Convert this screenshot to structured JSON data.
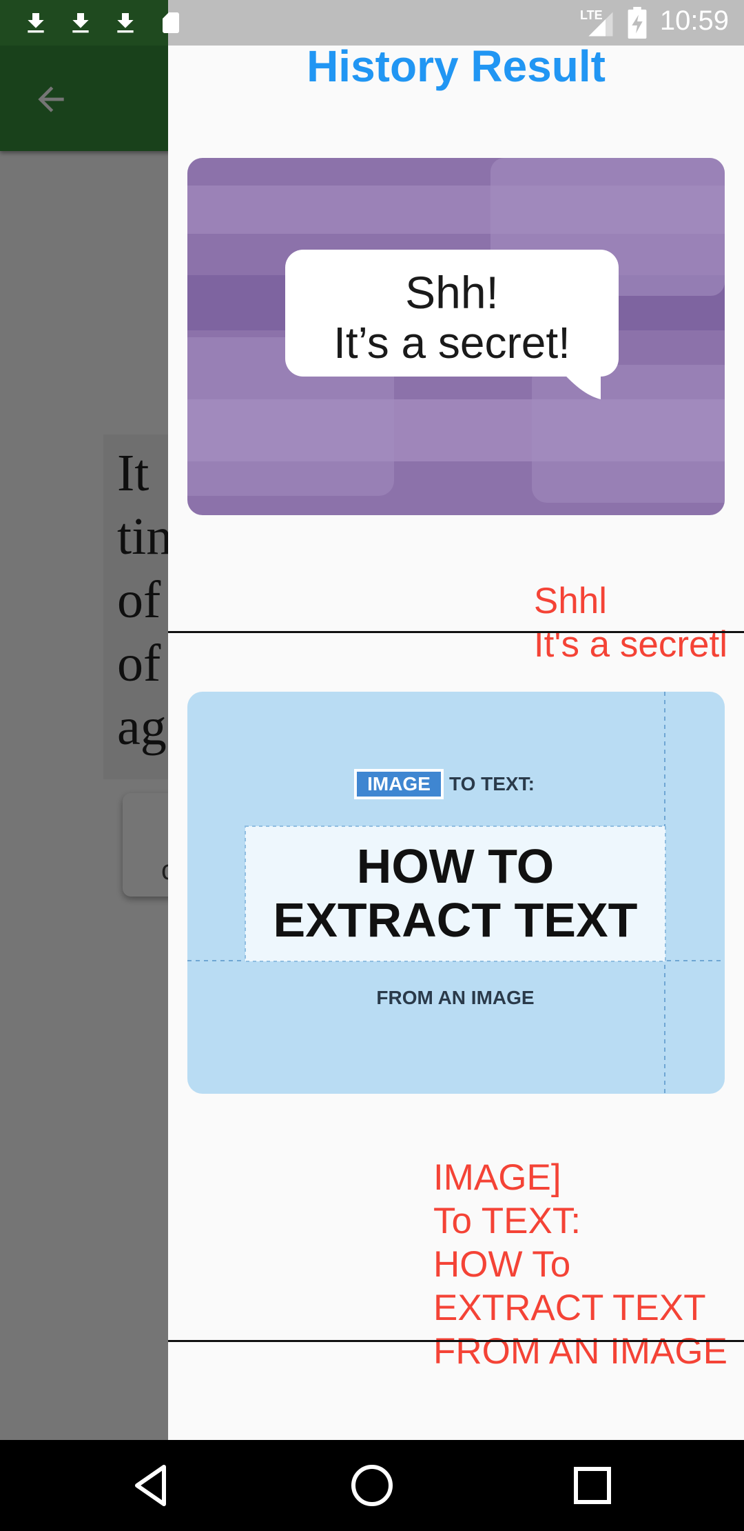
{
  "status_bar": {
    "time": "10:59",
    "network_label": "LTE",
    "left_icons": [
      "download-icon",
      "download-icon",
      "download-icon",
      "sd-card-icon"
    ],
    "right_icons": [
      "signal-icon",
      "battery-charging-icon"
    ],
    "colors": {
      "left_bg": "#1f4a1f",
      "right_bg": "#bdbdbd",
      "text": "#ffffff"
    }
  },
  "background_screen": {
    "app_bar_color": "#388e3c",
    "back_icon": "arrow-back-icon",
    "page_text_lines": [
      "It",
      "tin",
      "of",
      "of",
      "ag"
    ],
    "card_text": "c"
  },
  "drawer": {
    "title": "History Result",
    "title_color": "#2196f3",
    "items": [
      {
        "image": {
          "speech_bubble_text_line1": "Shh!",
          "speech_bubble_text_line2": "It’s a secret!",
          "bg_color": "#8c72aa"
        },
        "result_text": "Shhl\nIt's a secretl"
      },
      {
        "image": {
          "tag_highlight": "IMAGE",
          "tag_rest": "TO TEXT:",
          "headline_line1": "HOW TO",
          "headline_line2": "EXTRACT TEXT",
          "footer": "FROM AN IMAGE",
          "bg_color": "#b9dcf3"
        },
        "result_text": "IMAGE]\nTo TEXT:\nHOW To\nEXTRACT TEXT\nFROM AN IMAGE"
      }
    ],
    "result_text_color": "#f44336"
  },
  "nav_bar": {
    "buttons": [
      "back-triangle-icon",
      "home-circle-icon",
      "recents-square-icon"
    ]
  }
}
